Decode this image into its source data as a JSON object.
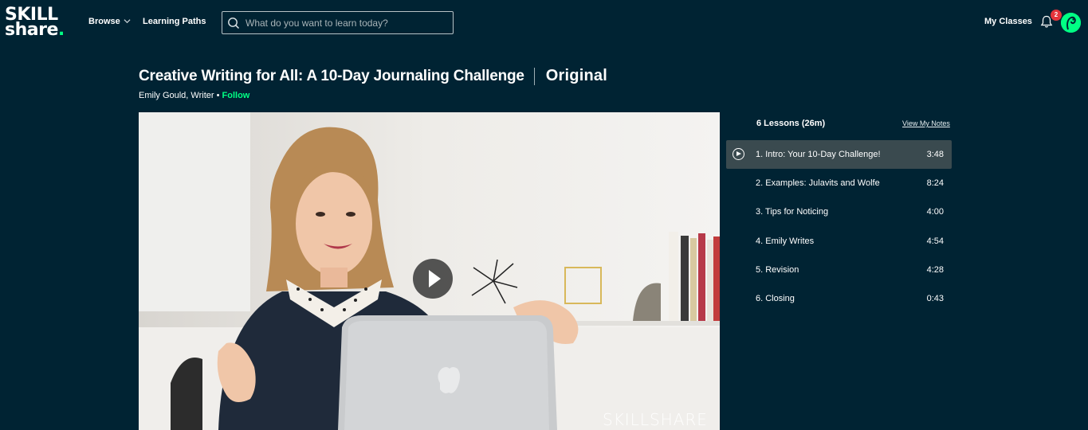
{
  "header": {
    "logo_line1": "SKILL",
    "logo_line2": "share",
    "logo_dot": ".",
    "browse_label": "Browse",
    "learning_paths_label": "Learning Paths",
    "search_placeholder": "What do you want to learn today?",
    "my_classes_label": "My Classes",
    "notification_count": "2"
  },
  "class": {
    "title": "Creative Writing for All: A 10-Day Journaling Challenge",
    "badge": "Original",
    "author": "Emily Gould, Writer",
    "separator": " • ",
    "follow_label": "Follow"
  },
  "video": {
    "watermark": "SKILLSHARE"
  },
  "lessons": {
    "header": "6 Lessons (26m)",
    "view_notes_label": "View My Notes",
    "items": [
      {
        "title": "1. Intro: Your 10-Day Challenge!",
        "duration": "3:48",
        "active": true
      },
      {
        "title": "2. Examples: Julavits and Wolfe",
        "duration": "8:24",
        "active": false
      },
      {
        "title": "3. Tips for Noticing",
        "duration": "4:00",
        "active": false
      },
      {
        "title": "4. Emily Writes",
        "duration": "4:54",
        "active": false
      },
      {
        "title": "5. Revision",
        "duration": "4:28",
        "active": false
      },
      {
        "title": "6. Closing",
        "duration": "0:43",
        "active": false
      }
    ]
  },
  "colors": {
    "background": "#002333",
    "accent": "#00ff84",
    "active_row": "#3a4a4f",
    "badge": "#e5353c"
  }
}
